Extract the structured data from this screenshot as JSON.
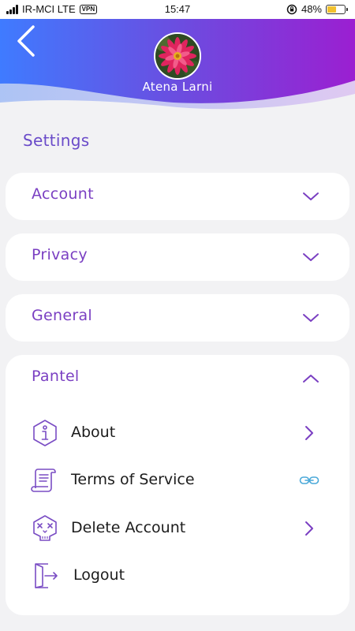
{
  "status_bar": {
    "carrier": "IR-MCI LTE",
    "vpn": "VPN",
    "time": "15:47",
    "battery_percent": "48%",
    "battery_level": 0.48
  },
  "header": {
    "user_name": "Atena Larni",
    "back_icon": "chevron-left-icon",
    "gradient_start": "#3f7bff",
    "gradient_end": "#9b1fd1"
  },
  "settings": {
    "title": "Settings",
    "sections": [
      {
        "label": "Account",
        "expanded": false
      },
      {
        "label": "Privacy",
        "expanded": false
      },
      {
        "label": "General",
        "expanded": false
      },
      {
        "label": "Pantel",
        "expanded": true
      }
    ],
    "pantel_items": [
      {
        "label": "About",
        "icon": "info-icon",
        "trailing": "chevron-right-icon"
      },
      {
        "label": "Terms of Service",
        "icon": "scroll-icon",
        "trailing": "link-icon"
      },
      {
        "label": "Delete Account",
        "icon": "skull-icon",
        "trailing": "chevron-right-icon"
      },
      {
        "label": "Logout",
        "icon": "logout-icon",
        "trailing": ""
      }
    ]
  },
  "colors": {
    "accent": "#7a3fc2",
    "title": "#6a4bc9",
    "link": "#4aa9d9",
    "background": "#f2f2f4"
  }
}
